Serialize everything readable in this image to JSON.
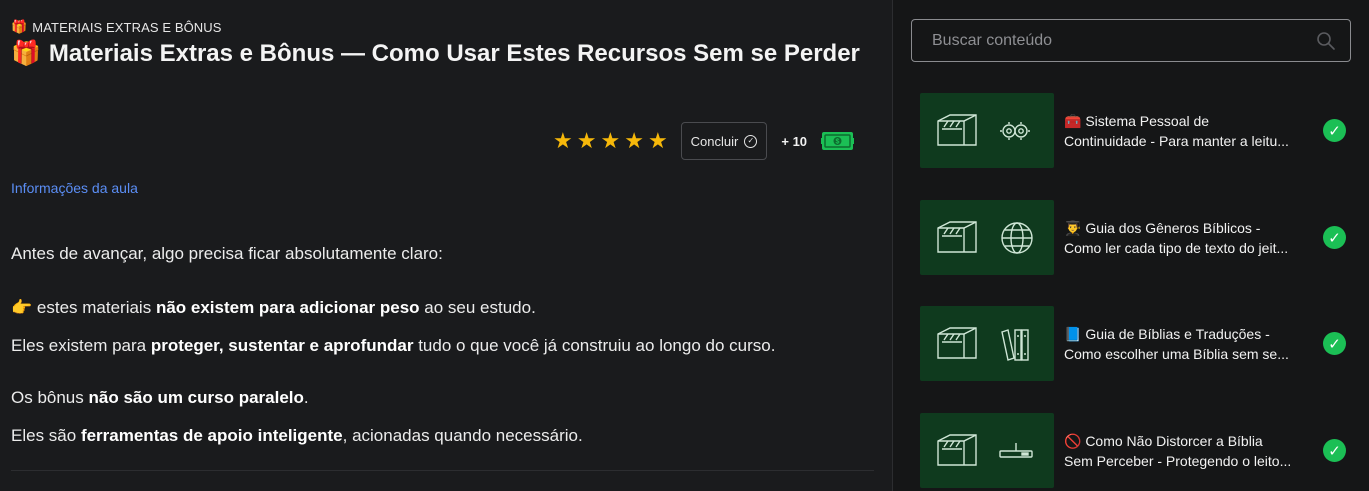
{
  "breadcrumb": {
    "icon": "🎁",
    "label": "MATERIAIS EXTRAS E BÔNUS"
  },
  "page_title": {
    "icon": "🎁",
    "text": "Materiais Extras e Bônus — Como Usar Estes Recursos Sem se Perder"
  },
  "rating": {
    "stars": 5,
    "max": 5
  },
  "actions": {
    "complete_label": "Concluir",
    "points": "+ 10"
  },
  "info_link": "Informações da aula",
  "content": {
    "p1": "Antes de avançar, algo precisa ficar absolutamente claro:",
    "p2_icon": "👉",
    "p2_pre": " estes materiais ",
    "p2_bold": "não existem para adicionar peso",
    "p2_post": " ao seu estudo.",
    "p3_pre": "Eles existem para ",
    "p3_bold": "proteger, sustentar e aprofundar",
    "p3_post": " tudo o que você já construiu ao longo do curso.",
    "p4_pre": "Os bônus ",
    "p4_bold": "não são um curso paralelo",
    "p4_post": ".",
    "p5_pre": "Eles são ",
    "p5_bold": "ferramentas de apoio inteligente",
    "p5_post": ", acionadas quando necessário."
  },
  "search": {
    "placeholder": "Buscar conteúdo"
  },
  "lessons": [
    {
      "l1": "🧰 Sistema Pessoal de",
      "l2": "Continuidade - Para manter a leitu...",
      "icon": "gears-icon",
      "done": true
    },
    {
      "l1": "👨‍🎓 Guia dos Gêneros Bíblicos -",
      "l2": "Como ler cada tipo de texto do jeit...",
      "icon": "globe-icon",
      "done": true
    },
    {
      "l1": "📘 Guia de Bíblias e Traduções -",
      "l2": "Como escolher uma Bíblia sem se...",
      "icon": "books-icon",
      "done": true
    },
    {
      "l1": "🚫 Como Não Distorcer a Bíblia",
      "l2": "Sem Perceber - Protegendo o leito...",
      "icon": "tool-icon",
      "done": true
    }
  ],
  "colors": {
    "accent_green": "#1bbf55",
    "thumb_bg": "#0f3a1e",
    "star": "#f6b80a",
    "link": "#5b8ef5"
  }
}
